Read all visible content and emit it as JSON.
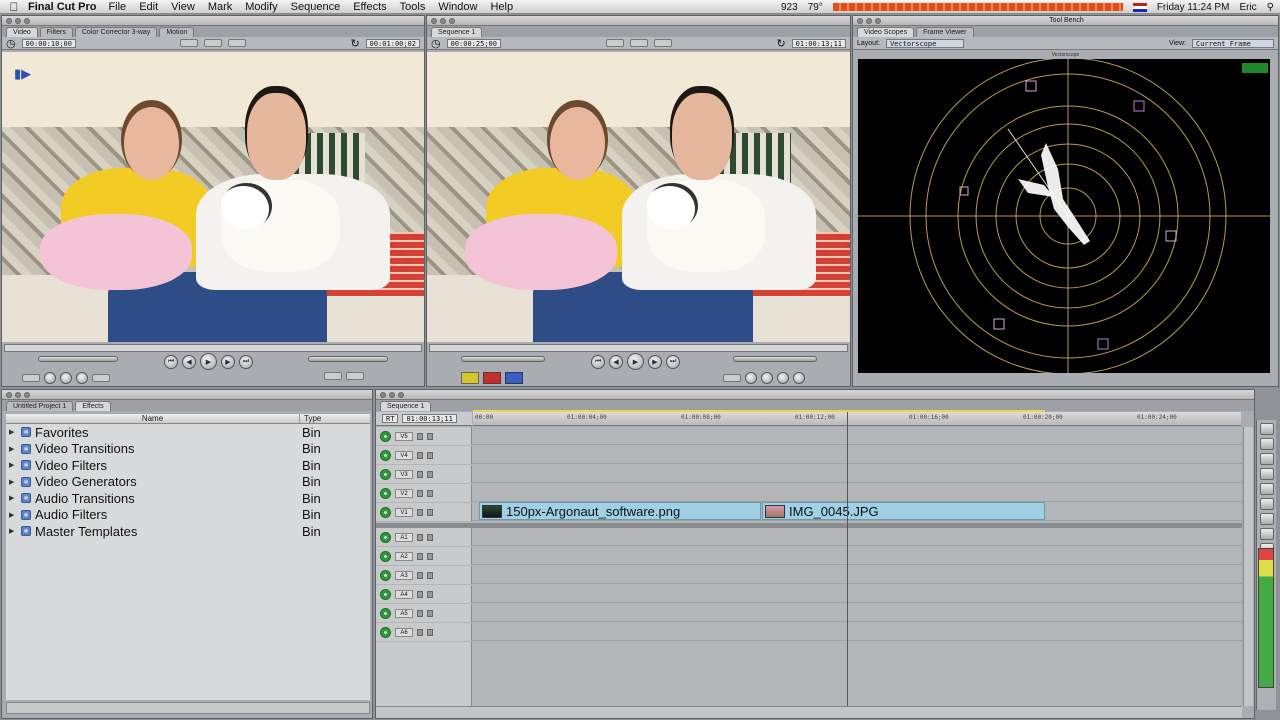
{
  "menubar": {
    "app_name": "Final Cut Pro",
    "items": [
      "File",
      "Edit",
      "View",
      "Mark",
      "Modify",
      "Sequence",
      "Effects",
      "Tools",
      "Window",
      "Help"
    ],
    "status": {
      "level": "923",
      "temp": "79°",
      "clock": "Friday 11:24 PM",
      "user": "Eric"
    }
  },
  "viewer": {
    "tabs": [
      "Video",
      "Filters",
      "Color Corrector 3-way",
      "Motion"
    ],
    "timecode_duration": "00:00:10;00",
    "timecode_current": "00:01:00;02"
  },
  "canvas": {
    "tabs": [
      "Sequence 1"
    ],
    "timecode_duration": "00:00:25;00",
    "timecode_current": "01:00:13;11"
  },
  "tool_bench": {
    "title": "Tool Bench",
    "tabs": [
      "Video Scopes",
      "Frame Viewer"
    ],
    "layout_label": "Layout:",
    "layout_value": "Vectorscope",
    "view_label": "View:",
    "view_value": "Current Frame",
    "scope_title": "Vectorscope"
  },
  "browser": {
    "tabs": [
      "Untitled Project 1",
      "Effects"
    ],
    "col_name": "Name",
    "col_type": "Type",
    "rows": [
      {
        "name": "Favorites",
        "type": "Bin"
      },
      {
        "name": "Video Transitions",
        "type": "Bin"
      },
      {
        "name": "Video Filters",
        "type": "Bin"
      },
      {
        "name": "Video Generators",
        "type": "Bin"
      },
      {
        "name": "Audio Transitions",
        "type": "Bin"
      },
      {
        "name": "Audio Filters",
        "type": "Bin"
      },
      {
        "name": "Master Templates",
        "type": "Bin"
      }
    ]
  },
  "timeline": {
    "tab": "Sequence 1",
    "rt": "RT",
    "timecode": "01:00:13;11",
    "ruler": [
      "00:00",
      "01:00:04;00",
      "01:00:08;00",
      "01:00:12;00",
      "01:00:16;00",
      "01:00:20;00",
      "01:00:24;00"
    ],
    "video_tracks": [
      "V5",
      "V4",
      "V3",
      "V2",
      "V1"
    ],
    "audio_tracks": [
      "A1",
      "A2",
      "A3",
      "A4",
      "A5",
      "A6"
    ],
    "clips": [
      {
        "name": "150px-Argonaut_software.png"
      },
      {
        "name": "IMG_0045.JPG"
      }
    ]
  }
}
